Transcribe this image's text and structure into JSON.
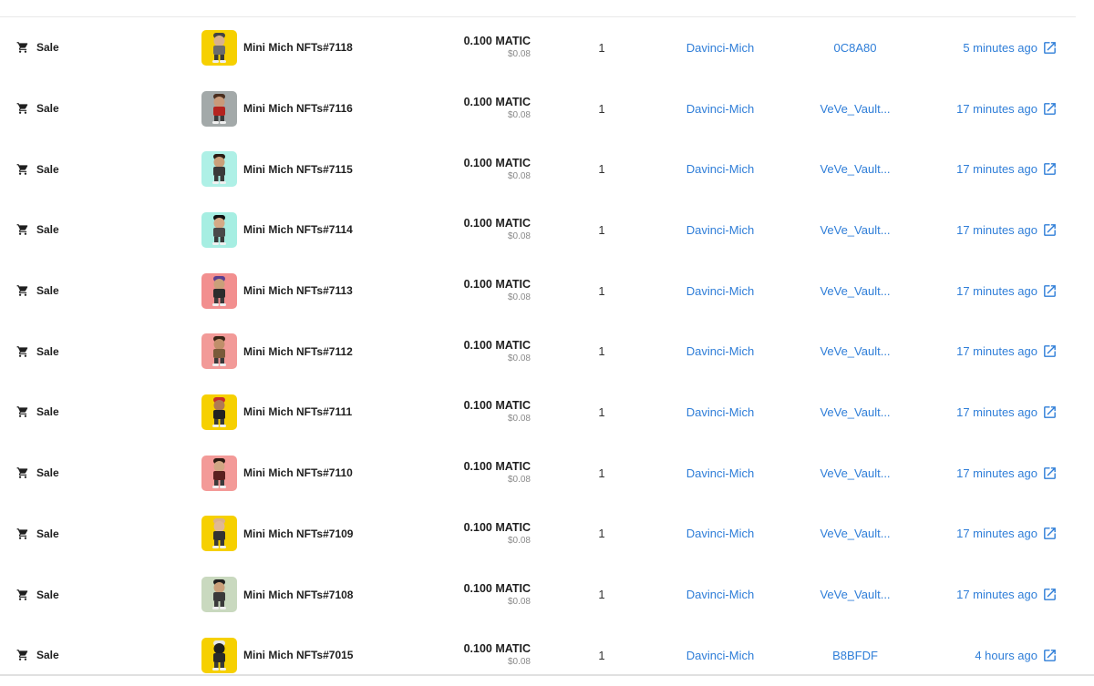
{
  "icons": {
    "event": "cart-icon",
    "link": "external-link-icon"
  },
  "colors": {
    "link": "#2f7ed8",
    "muted": "#8a8a8a",
    "text": "#1f1f1f"
  },
  "rows": [
    {
      "event": "Sale",
      "item": "Mini Mich NFTs#7118",
      "price": "0.100 MATIC",
      "usd": "$0.08",
      "qty": "1",
      "from": "Davinci-Mich",
      "to": "0C8A80",
      "time": "5 minutes ago",
      "bg": "#f6d000",
      "skin": "#d9b08c",
      "shirt": "#6b6b6b",
      "hair": "#444444"
    },
    {
      "event": "Sale",
      "item": "Mini Mich NFTs#7116",
      "price": "0.100 MATIC",
      "usd": "$0.08",
      "qty": "1",
      "from": "Davinci-Mich",
      "to": "VeVe_Vault...",
      "time": "17 minutes ago",
      "bg": "#a3a9a9",
      "skin": "#c99a7a",
      "shirt": "#b5231f",
      "hair": "#4a2e1e"
    },
    {
      "event": "Sale",
      "item": "Mini Mich NFTs#7115",
      "price": "0.100 MATIC",
      "usd": "$0.08",
      "qty": "1",
      "from": "Davinci-Mich",
      "to": "VeVe_Vault...",
      "time": "17 minutes ago",
      "bg": "#aef0e6",
      "skin": "#caa07a",
      "shirt": "#3a3a3a",
      "hair": "#2b1d14"
    },
    {
      "event": "Sale",
      "item": "Mini Mich NFTs#7114",
      "price": "0.100 MATIC",
      "usd": "$0.08",
      "qty": "1",
      "from": "Davinci-Mich",
      "to": "VeVe_Vault...",
      "time": "17 minutes ago",
      "bg": "#a6eee2",
      "skin": "#d4aa86",
      "shirt": "#4a4a4a",
      "hair": "#111111"
    },
    {
      "event": "Sale",
      "item": "Mini Mich NFTs#7113",
      "price": "0.100 MATIC",
      "usd": "$0.08",
      "qty": "1",
      "from": "Davinci-Mich",
      "to": "VeVe_Vault...",
      "time": "17 minutes ago",
      "bg": "#f28f8f",
      "skin": "#caa07a",
      "shirt": "#2c2c2c",
      "hair": "#5a3f8f"
    },
    {
      "event": "Sale",
      "item": "Mini Mich NFTs#7112",
      "price": "0.100 MATIC",
      "usd": "$0.08",
      "qty": "1",
      "from": "Davinci-Mich",
      "to": "VeVe_Vault...",
      "time": "17 minutes ago",
      "bg": "#f29a98",
      "skin": "#c08f6a",
      "shirt": "#7a5a3a",
      "hair": "#3a2516"
    },
    {
      "event": "Sale",
      "item": "Mini Mich NFTs#7111",
      "price": "0.100 MATIC",
      "usd": "$0.08",
      "qty": "1",
      "from": "Davinci-Mich",
      "to": "VeVe_Vault...",
      "time": "17 minutes ago",
      "bg": "#f6d000",
      "skin": "#b07a55",
      "shirt": "#222222",
      "hair": "#c62d2d"
    },
    {
      "event": "Sale",
      "item": "Mini Mich NFTs#7110",
      "price": "0.100 MATIC",
      "usd": "$0.08",
      "qty": "1",
      "from": "Davinci-Mich",
      "to": "VeVe_Vault...",
      "time": "17 minutes ago",
      "bg": "#f39a98",
      "skin": "#d0a683",
      "shirt": "#5a1f1f",
      "hair": "#2a1a12"
    },
    {
      "event": "Sale",
      "item": "Mini Mich NFTs#7109",
      "price": "0.100 MATIC",
      "usd": "$0.08",
      "qty": "1",
      "from": "Davinci-Mich",
      "to": "VeVe_Vault...",
      "time": "17 minutes ago",
      "bg": "#f6d000",
      "skin": "#e0b894",
      "shirt": "#333333",
      "hair": "#d9b08c"
    },
    {
      "event": "Sale",
      "item": "Mini Mich NFTs#7108",
      "price": "0.100 MATIC",
      "usd": "$0.08",
      "qty": "1",
      "from": "Davinci-Mich",
      "to": "VeVe_Vault...",
      "time": "17 minutes ago",
      "bg": "#c9d9bf",
      "skin": "#caa07a",
      "shirt": "#3a3a3a",
      "hair": "#1f1f1f"
    },
    {
      "event": "Sale",
      "item": "Mini Mich NFTs#7015",
      "price": "0.100 MATIC",
      "usd": "$0.08",
      "qty": "1",
      "from": "Davinci-Mich",
      "to": "B8BFDF",
      "time": "4 hours ago",
      "bg": "#f6d000",
      "skin": "#1f1f1f",
      "shirt": "#2a2a2a",
      "hair": "#e6e6e6"
    }
  ]
}
